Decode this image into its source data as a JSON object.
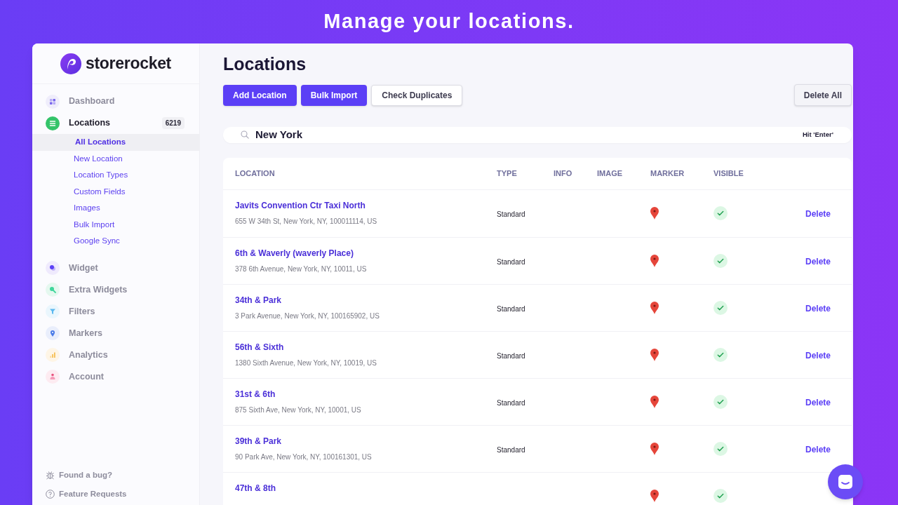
{
  "banner": {
    "title": "Manage your locations."
  },
  "sidebar": {
    "logo": "storerocket",
    "nav": [
      {
        "label": "Dashboard",
        "selected": false
      },
      {
        "label": "Locations",
        "selected": true,
        "badge": "6219",
        "children": [
          {
            "label": "All Locations",
            "selected": true
          },
          {
            "label": "New Location",
            "selected": false
          },
          {
            "label": "Location Types",
            "selected": false
          },
          {
            "label": "Custom Fields",
            "selected": false
          },
          {
            "label": "Images",
            "selected": false
          },
          {
            "label": "Bulk Import",
            "selected": false
          },
          {
            "label": "Google Sync",
            "selected": false
          }
        ]
      },
      {
        "label": "Widget",
        "selected": false
      },
      {
        "label": "Extra Widgets",
        "selected": false
      },
      {
        "label": "Filters",
        "selected": false
      },
      {
        "label": "Markers",
        "selected": false
      },
      {
        "label": "Analytics",
        "selected": false
      },
      {
        "label": "Account",
        "selected": false
      }
    ],
    "footer_links": [
      {
        "label": "Found a bug?",
        "kind": "bug"
      },
      {
        "label": "Feature Requests",
        "kind": "help"
      }
    ]
  },
  "page": {
    "title": "Locations",
    "actions": [
      {
        "label": "Add Location",
        "kind": "primary"
      },
      {
        "label": "Bulk Import",
        "kind": "primary"
      },
      {
        "label": "Check Duplicates",
        "kind": "secondary"
      }
    ],
    "actions_right": [
      {
        "label": "Delete All",
        "kind": "muted"
      }
    ]
  },
  "search": {
    "value": "New York",
    "hint": "Hit 'Enter'"
  },
  "table": {
    "columns": [
      "LOCATION",
      "TYPE",
      "INFO",
      "IMAGE",
      "MARKER",
      "VISIBLE"
    ],
    "rows": [
      {
        "name": "Javits Convention Ctr Taxi North",
        "address": "655 W 34th St, New York, NY, 100011114, US",
        "type": "Standard",
        "visible": true,
        "action": "Delete"
      },
      {
        "name": "6th & Waverly (waverly Place)",
        "address": "378 6th Avenue, New York, NY, 10011, US",
        "type": "Standard",
        "visible": true,
        "action": "Delete"
      },
      {
        "name": "34th & Park",
        "address": "3 Park Avenue, New York, NY, 100165902, US",
        "type": "Standard",
        "visible": true,
        "action": "Delete"
      },
      {
        "name": "56th & Sixth",
        "address": "1380 Sixth Avenue, New York, NY, 10019, US",
        "type": "Standard",
        "visible": true,
        "action": "Delete"
      },
      {
        "name": "31st & 6th",
        "address": "875 Sixth Ave, New York, NY, 10001, US",
        "type": "Standard",
        "visible": true,
        "action": "Delete"
      },
      {
        "name": "39th & Park",
        "address": "90 Park Ave, New York, NY, 100161301, US",
        "type": "Standard",
        "visible": true,
        "action": "Delete"
      },
      {
        "name": "47th & 8th",
        "visible": true
      }
    ]
  }
}
